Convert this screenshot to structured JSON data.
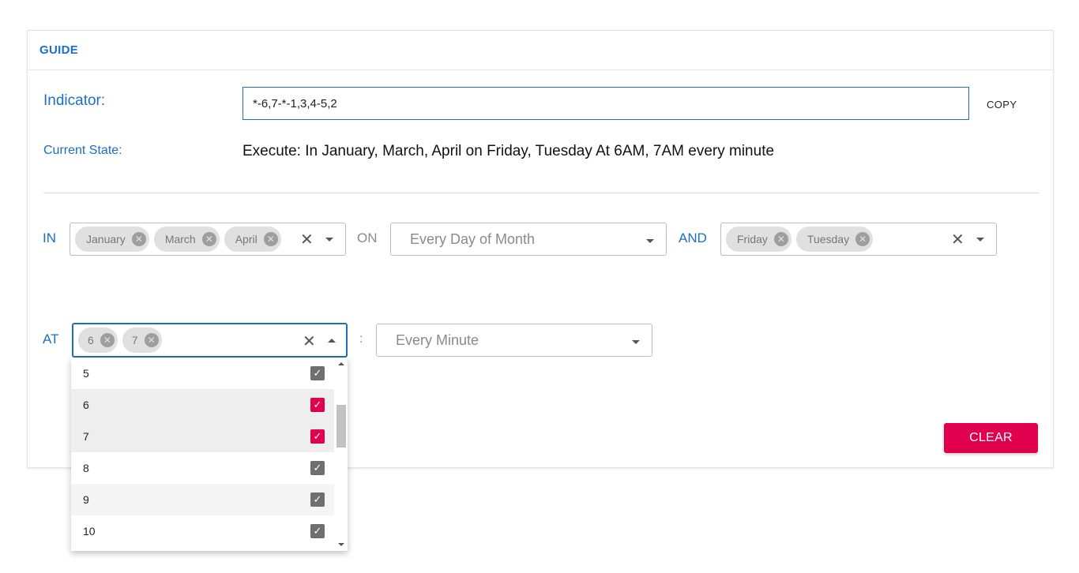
{
  "header": {
    "title": "GUIDE"
  },
  "indicator": {
    "label": "Indicator:",
    "value": "*-6,7-*-1,3,4-5,2",
    "copy_label": "COPY"
  },
  "current_state": {
    "label": "Current State:",
    "value": "Execute: In January, March, April on Friday, Tuesday At 6AM, 7AM every minute"
  },
  "in_row": {
    "label": "IN",
    "months": [
      "January",
      "March",
      "April"
    ],
    "on_label": "ON",
    "day_placeholder": "Every Day of Month",
    "and_label": "AND",
    "weekdays": [
      "Friday",
      "Tuesday"
    ]
  },
  "at_row": {
    "label": "AT",
    "hours": [
      "6",
      "7"
    ],
    "separator": ":",
    "minute_placeholder": "Every Minute"
  },
  "clear_label": "CLEAR",
  "dropdown": {
    "items": [
      {
        "label": "5",
        "checked": false
      },
      {
        "label": "6",
        "checked": true
      },
      {
        "label": "7",
        "checked": true
      },
      {
        "label": "8",
        "checked": false
      },
      {
        "label": "9",
        "checked": false
      },
      {
        "label": "10",
        "checked": false
      }
    ]
  },
  "colors": {
    "accent": "#1a6fc4",
    "danger": "#e0004d",
    "checked": "#e0004d",
    "unchecked": "#6f6f6f"
  },
  "icons": {
    "chip_remove": "circle-x-icon",
    "clear": "close-icon",
    "dropdown": "caret-down-icon",
    "check": "checkbox-icon"
  }
}
